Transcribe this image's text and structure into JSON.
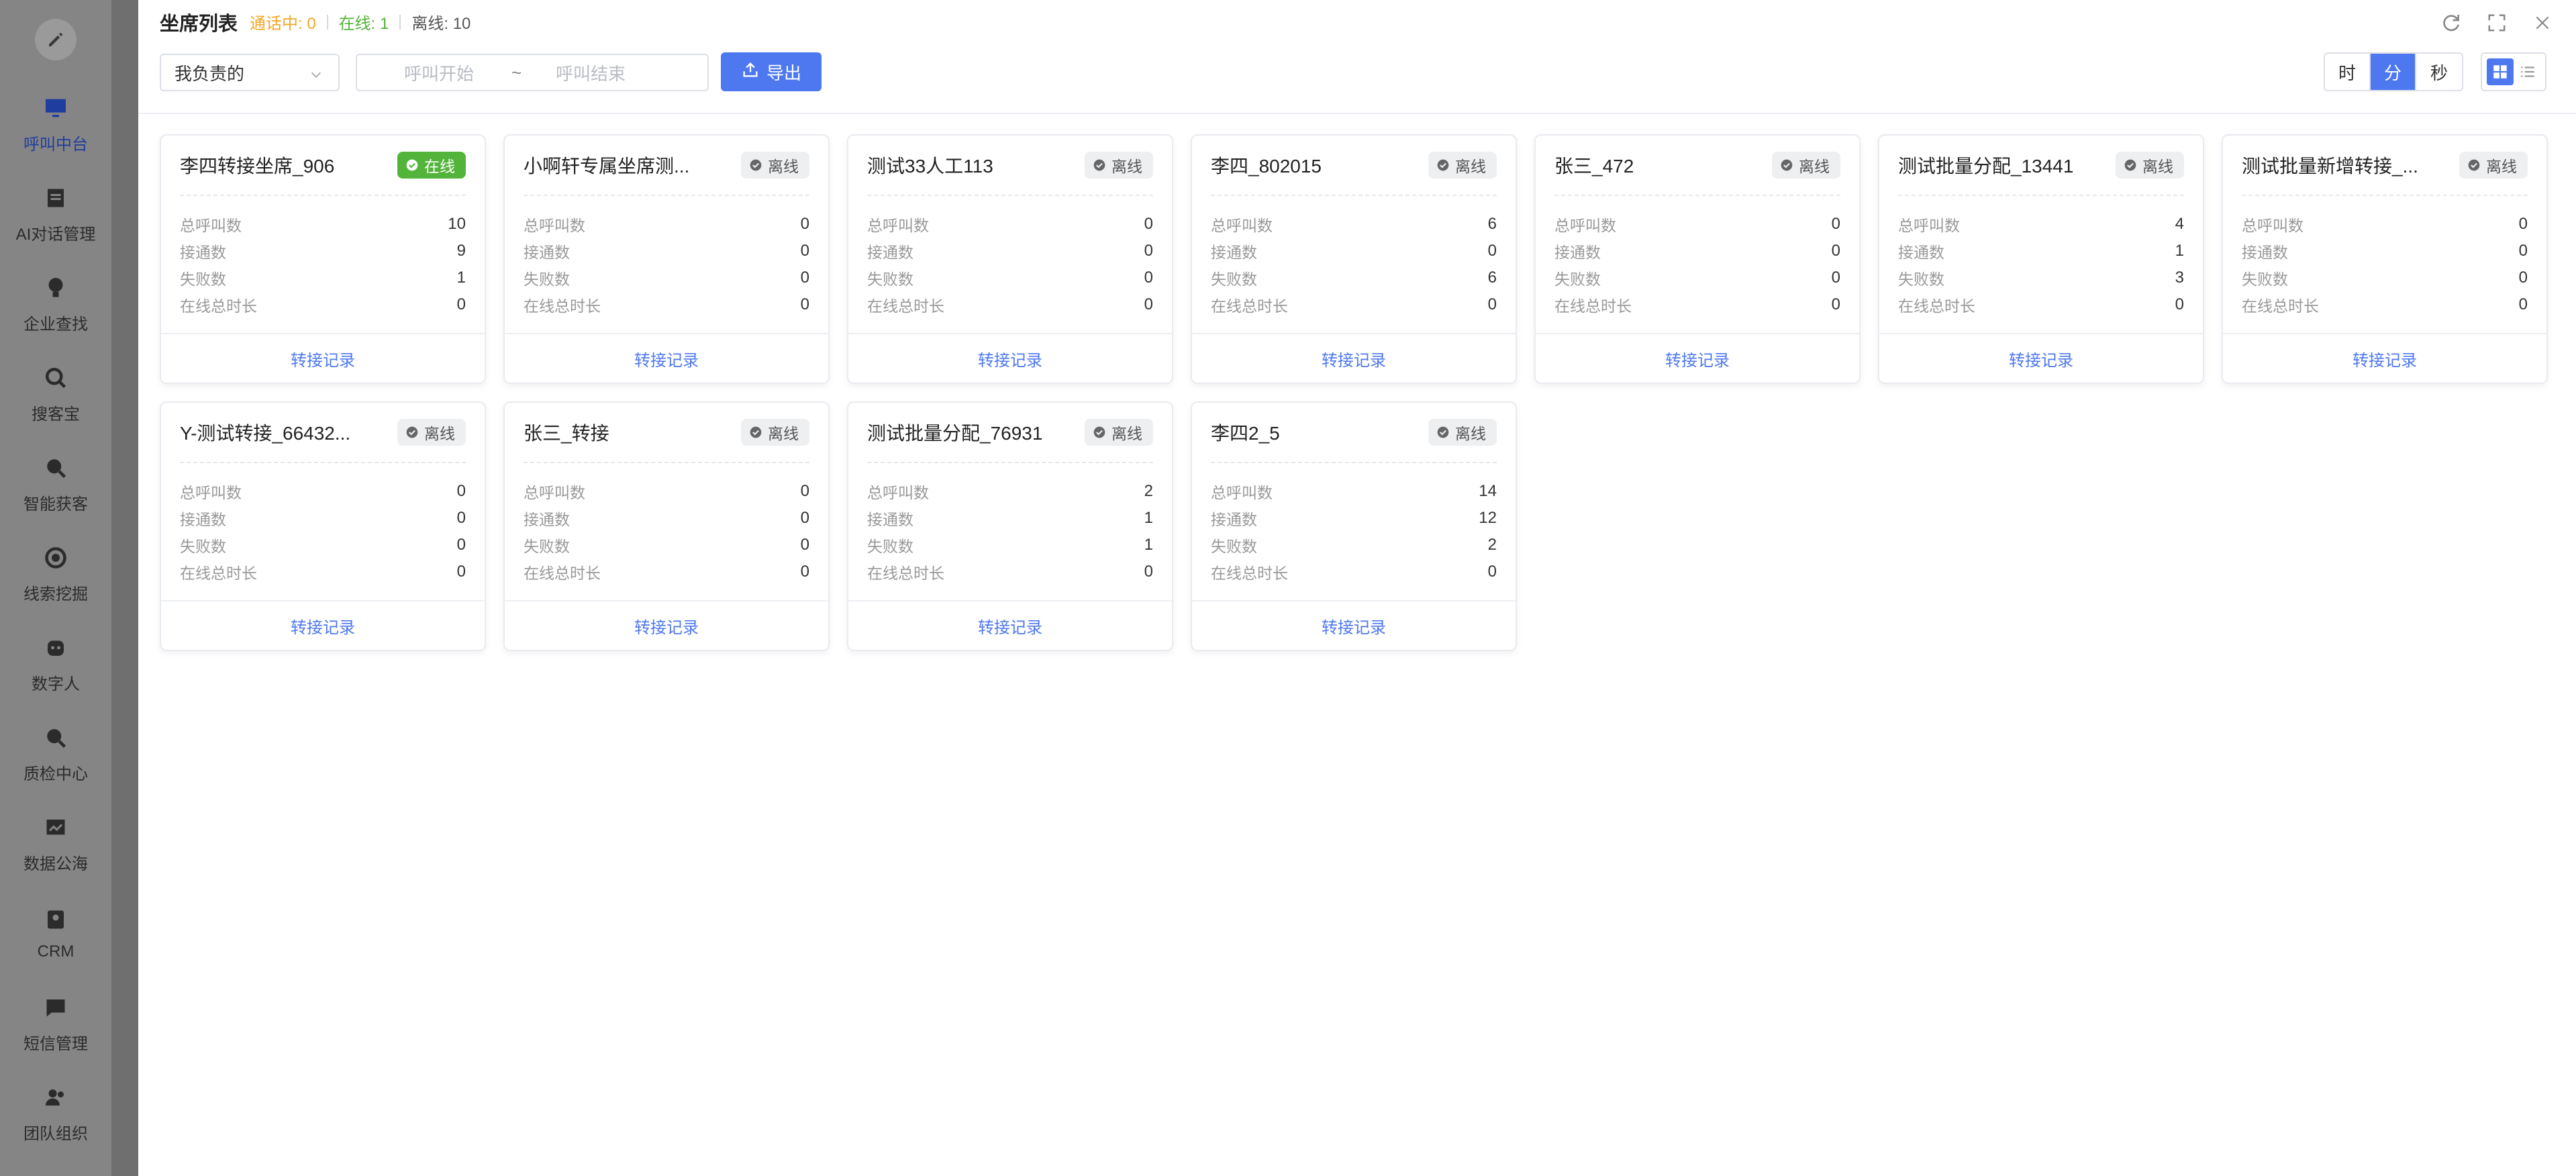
{
  "sidebar": {
    "items": [
      {
        "label": "呼叫中台",
        "icon": "monitor-icon",
        "active": true
      },
      {
        "label": "AI对话管理",
        "icon": "document-icon",
        "active": false
      },
      {
        "label": "企业查找",
        "icon": "bulb-icon",
        "active": false
      },
      {
        "label": "搜客宝",
        "icon": "search-icon",
        "active": false
      },
      {
        "label": "智能获客",
        "icon": "search-icon",
        "active": false
      },
      {
        "label": "线索挖掘",
        "icon": "target-icon",
        "active": false
      },
      {
        "label": "数字人",
        "icon": "robot-icon",
        "active": false
      },
      {
        "label": "质检中心",
        "icon": "search-icon",
        "active": false
      },
      {
        "label": "数据公海",
        "icon": "chart-icon",
        "active": false
      },
      {
        "label": "CRM",
        "icon": "contacts-icon",
        "active": false
      },
      {
        "label": "短信管理",
        "icon": "message-icon",
        "active": false
      },
      {
        "label": "团队组织",
        "icon": "team-icon",
        "active": false
      }
    ]
  },
  "header": {
    "title": "坐席列表",
    "talking": "通话中: 0",
    "online": "在线: 1",
    "offline": "离线: 10"
  },
  "filters": {
    "scope": "我负责的",
    "start_placeholder": "呼叫开始",
    "tilde": "~",
    "end_placeholder": "呼叫结束",
    "export_label": "导出"
  },
  "units": [
    {
      "label": "时",
      "active": false
    },
    {
      "label": "分",
      "active": true
    },
    {
      "label": "秒",
      "active": false
    }
  ],
  "stat_labels": {
    "total": "总呼叫数",
    "connected": "接通数",
    "failed": "失败数",
    "online_time": "在线总时长"
  },
  "footer_label": "转接记录",
  "colors": {
    "accent": "#4e78f0",
    "online": "#52b43a",
    "talking": "#f5a623"
  },
  "cards": [
    {
      "name": "李四转接坐席_906",
      "status": "在线",
      "online": true,
      "total": "10",
      "connected": "9",
      "failed": "1",
      "online_time": "0"
    },
    {
      "name": "小啊轩专属坐席测...",
      "status": "离线",
      "online": false,
      "total": "0",
      "connected": "0",
      "failed": "0",
      "online_time": "0"
    },
    {
      "name": "测试33人工113",
      "status": "离线",
      "online": false,
      "total": "0",
      "connected": "0",
      "failed": "0",
      "online_time": "0"
    },
    {
      "name": "李四_802015",
      "status": "离线",
      "online": false,
      "total": "6",
      "connected": "0",
      "failed": "6",
      "online_time": "0"
    },
    {
      "name": "张三_472",
      "status": "离线",
      "online": false,
      "total": "0",
      "connected": "0",
      "failed": "0",
      "online_time": "0"
    },
    {
      "name": "测试批量分配_13441",
      "status": "离线",
      "online": false,
      "total": "4",
      "connected": "1",
      "failed": "3",
      "online_time": "0"
    },
    {
      "name": "测试批量新增转接_...",
      "status": "离线",
      "online": false,
      "total": "0",
      "connected": "0",
      "failed": "0",
      "online_time": "0"
    },
    {
      "name": "Y-测试转接_66432...",
      "status": "离线",
      "online": false,
      "total": "0",
      "connected": "0",
      "failed": "0",
      "online_time": "0"
    },
    {
      "name": "张三_转接",
      "status": "离线",
      "online": false,
      "total": "0",
      "connected": "0",
      "failed": "0",
      "online_time": "0"
    },
    {
      "name": "测试批量分配_76931",
      "status": "离线",
      "online": false,
      "total": "2",
      "connected": "1",
      "failed": "1",
      "online_time": "0"
    },
    {
      "name": "李四2_5",
      "status": "离线",
      "online": false,
      "total": "14",
      "connected": "12",
      "failed": "2",
      "online_time": "0"
    }
  ]
}
